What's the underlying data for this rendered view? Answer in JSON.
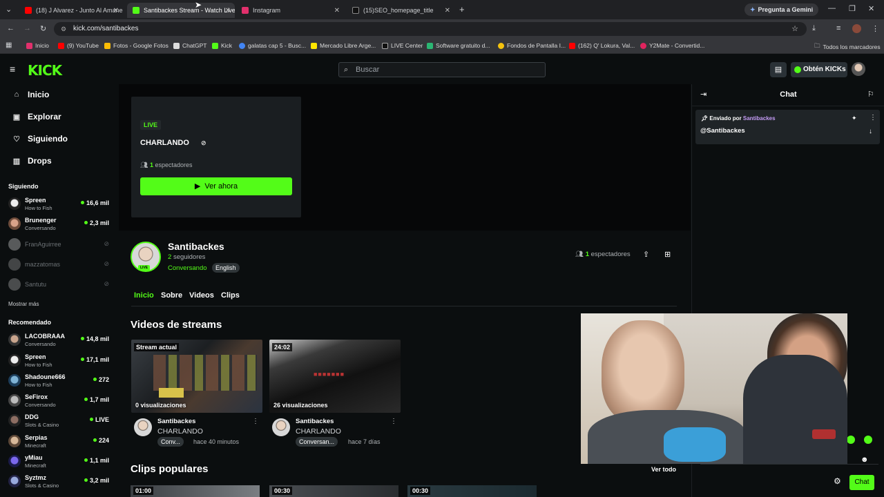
{
  "browser": {
    "tabs": [
      {
        "title": "(18) J Alvarez - Junto Al Amanecer",
        "favicon_color": "#ff0000"
      },
      {
        "title": "Santibackes Stream - Watch Live",
        "favicon_color": "#53fc18"
      },
      {
        "title": "Instagram",
        "favicon_color": "#e1306c"
      },
      {
        "title": "(15)SEO_homepage_title",
        "favicon_color": "#111111"
      }
    ],
    "gemini_label": "Pregunta a Gemini",
    "url": "kick.com/santibackes",
    "bookmarks": [
      "Inicio",
      "(9) YouTube",
      "Fotos - Google Fotos",
      "ChatGPT",
      "Kick",
      "galatas cap 5 - Busc...",
      "Mercado Libre Arge...",
      "LIVE Center",
      "Software gratuito d...",
      "Fondos de Pantalla I...",
      "(162) Q' Lokura, Val...",
      "Y2Mate - Convertid..."
    ],
    "all_bookmarks_label": "Todos los marcadores"
  },
  "header": {
    "logo": "KICK",
    "search_placeholder": "Buscar",
    "get_kicks_label": "Obtén KICKs"
  },
  "sidebar": {
    "nav": [
      {
        "label": "Inicio",
        "icon": "home-icon"
      },
      {
        "label": "Explorar",
        "icon": "compass-icon"
      },
      {
        "label": "Siguiendo",
        "icon": "heart-icon"
      },
      {
        "label": "Drops",
        "icon": "gift-icon"
      }
    ],
    "following_title": "Siguiendo",
    "following": [
      {
        "name": "Spreen",
        "category": "How to Fish",
        "viewers": "16,6 mil"
      },
      {
        "name": "Brunenger",
        "category": "Conversando",
        "viewers": "2,3 mil"
      },
      {
        "name": "FranAguirree",
        "offline": true
      },
      {
        "name": "mazzatomas",
        "offline": true
      },
      {
        "name": "Santutu",
        "offline": true
      }
    ],
    "show_more": "Mostrar más",
    "recommended_title": "Recomendado",
    "recommended": [
      {
        "name": "LACOBRAAA",
        "category": "Conversando",
        "viewers": "14,8 mil"
      },
      {
        "name": "Spreen",
        "category": "How to Fish",
        "viewers": "17,1 mil"
      },
      {
        "name": "Shadoune666",
        "category": "How to Fish",
        "viewers": "272"
      },
      {
        "name": "SeFirox",
        "category": "Conversando",
        "viewers": "1,7 mil"
      },
      {
        "name": "DDG",
        "category": "Slots & Casino",
        "viewers": "LIVE"
      },
      {
        "name": "Serpias",
        "category": "Minecraft",
        "viewers": "224"
      },
      {
        "name": "yMiau",
        "category": "Minecraft",
        "viewers": "1,1 mil"
      },
      {
        "name": "Syztmz",
        "category": "Slots & Casino",
        "viewers": "3,2 mil"
      }
    ]
  },
  "live_card": {
    "badge": "LIVE",
    "title": "CHARLANDO",
    "viewers_count": "1",
    "viewers_label": "espectadores",
    "watch_label": "Ver ahora"
  },
  "channel": {
    "name": "Santibackes",
    "live_pill": "LIVE",
    "followers_count": "2",
    "followers_label": "seguidores",
    "category": "Conversando",
    "language": "English",
    "viewers_count": "1",
    "viewers_label": "espectadores",
    "tabs": [
      "Inicio",
      "Sobre",
      "Videos",
      "Clips"
    ]
  },
  "videos_section": {
    "title": "Videos de streams",
    "items": [
      {
        "tag": "Stream actual",
        "views": "0 visualizaciones",
        "channel": "Santibackes",
        "title": "CHARLANDO",
        "category": "Conv...",
        "ago": "hace 40 minutos"
      },
      {
        "tag": "24:02",
        "views": "26 visualizaciones",
        "channel": "Santibackes",
        "title": "CHARLANDO",
        "category": "Conversan...",
        "ago": "hace 7 días"
      }
    ]
  },
  "clips_section": {
    "title": "Clips populares",
    "durations": [
      "01:00",
      "00:30",
      "00:30"
    ]
  },
  "chat": {
    "title": "Chat",
    "pinned_prefix": "Enviado por",
    "pinned_user": "Santibackes",
    "pinned_message": "@Santibackes",
    "chat_button": "Chat",
    "see_all": "Ver todo"
  },
  "colors": {
    "accent": "#53fc18",
    "background": "#0b0e0f"
  }
}
